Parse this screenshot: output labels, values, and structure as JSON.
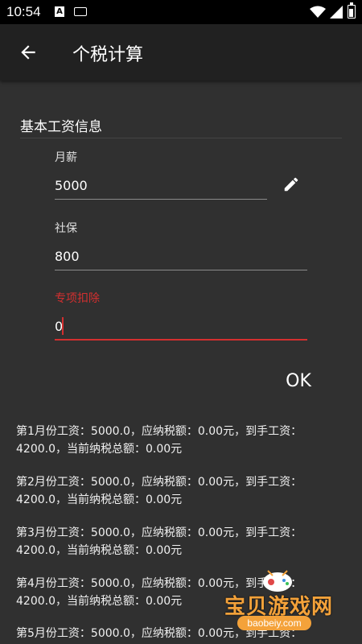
{
  "status_bar": {
    "time": "10:54",
    "app_icon_letter": "A"
  },
  "app_bar": {
    "title": "个税计算"
  },
  "section": {
    "title": "基本工资信息"
  },
  "fields": {
    "salary": {
      "label": "月薪",
      "value": "5000"
    },
    "social_security": {
      "label": "社保",
      "value": "800"
    },
    "special_deduction": {
      "label": "专项扣除",
      "value": "0"
    }
  },
  "ok_label": "OK",
  "results": [
    {
      "line1": "第1月份工资：5000.0，应纳税额：0.00元，到手工资：",
      "line2": "4200.0，当前纳税总额：0.00元"
    },
    {
      "line1": "第2月份工资：5000.0，应纳税额：0.00元，到手工资：",
      "line2": "4200.0，当前纳税总额：0.00元"
    },
    {
      "line1": "第3月份工资：5000.0，应纳税额：0.00元，到手工资：",
      "line2": "4200.0，当前纳税总额：0.00元"
    },
    {
      "line1": "第4月份工资：5000.0，应纳税额：0.00元，到手工资：",
      "line2": "4200.0，当前纳税总额：0.00元"
    },
    {
      "line1": "第5月份工资：5000.0，应纳税额：0.00元，到手工资：",
      "line2": ""
    }
  ],
  "watermark": {
    "text": "宝贝游戏网",
    "url": "baobeiy.com"
  },
  "colors": {
    "background": "#303030",
    "app_bar": "#212121",
    "accent": "#d32f2f",
    "watermark": "#f4a23a"
  }
}
